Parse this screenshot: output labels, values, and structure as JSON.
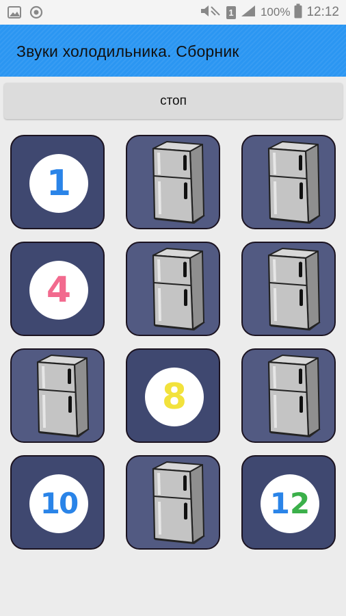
{
  "status_bar": {
    "battery_percent": "100%",
    "time": "12:12",
    "sim_label": "1",
    "icons": [
      "image-icon",
      "sync-icon",
      "mute-icon",
      "sim-icon",
      "signal-icon",
      "battery-icon"
    ]
  },
  "app_bar": {
    "title": "Звуки холодильника. Сборник",
    "color": "#2b96f2"
  },
  "controls": {
    "stop_label": "стоп"
  },
  "grid": {
    "tiles": [
      {
        "type": "number",
        "label": "1"
      },
      {
        "type": "fridge"
      },
      {
        "type": "fridge"
      },
      {
        "type": "number",
        "label": "4"
      },
      {
        "type": "fridge"
      },
      {
        "type": "fridge"
      },
      {
        "type": "fridge"
      },
      {
        "type": "number",
        "label": "8"
      },
      {
        "type": "fridge"
      },
      {
        "type": "number",
        "label": "10"
      },
      {
        "type": "fridge"
      },
      {
        "type": "number",
        "label": "12",
        "label_parts": [
          "1",
          "2"
        ]
      }
    ]
  }
}
